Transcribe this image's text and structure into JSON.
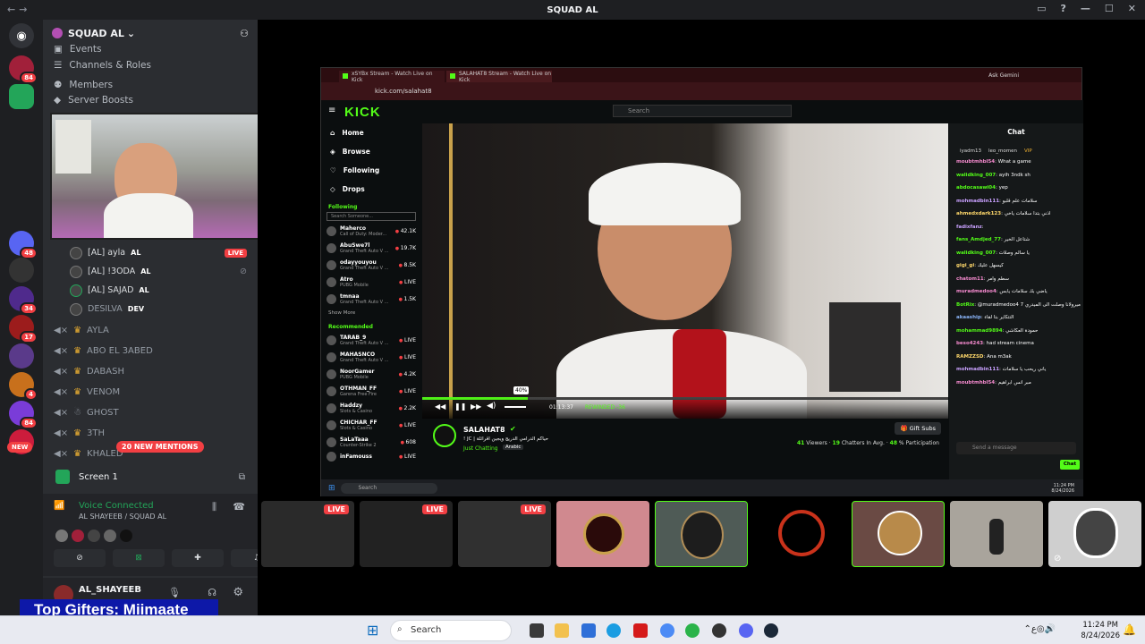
{
  "window": {
    "title": "SQUAD AL"
  },
  "server": {
    "name": "SQUAD AL",
    "menu": [
      "Events",
      "Channels & Roles",
      "Members",
      "Server Boosts"
    ]
  },
  "server_badges": [
    "84",
    "48",
    "34",
    "17",
    "4",
    "84",
    "NEW"
  ],
  "mentions": "20 NEW MENTIONS",
  "voice_users": [
    {
      "name": "[AL] ayla",
      "tag": "AL",
      "live": "LIVE"
    },
    {
      "name": "[AL] !3ODA",
      "tag": "AL"
    },
    {
      "name": "[AL] SAJAD",
      "tag": "AL"
    },
    {
      "name": "DESILVA",
      "tag": "DEV"
    }
  ],
  "category_users": [
    "AYLA",
    "ABO EL 3ABED",
    "DABASH",
    "VENOM",
    "GHOST",
    "3TH",
    "KHALED"
  ],
  "screen": {
    "label": "Screen 1"
  },
  "voice": {
    "status": "Voice Connected",
    "channel": "AL SHAYEEB / SQUAD AL"
  },
  "user": {
    "name": "AL_SHAYEEB"
  },
  "ticker": {
    "text": "Top Gifters: Miimaate"
  },
  "browser": {
    "tabs": [
      "xSYBx Stream - Watch Live on Kick",
      "SALAHAT8 Stream - Watch Live on Kick"
    ],
    "url": "kick.com/salahat8",
    "ask": "Ask Gemini"
  },
  "kick": {
    "logo": "KICK",
    "search_placeholder": "Search",
    "nav": [
      "Home",
      "Browse",
      "Following",
      "Drops"
    ],
    "following_header": "Following",
    "following_search": "Search Someone...",
    "following": [
      {
        "name": "Maherco",
        "game": "Call of Duty: Moder...",
        "count": "42.1K"
      },
      {
        "name": "AbuSwe7l",
        "game": "Grand Theft Auto V ...",
        "count": "19.7K"
      },
      {
        "name": "odayyouyou",
        "game": "Grand Theft Auto V ...",
        "count": "8.5K"
      },
      {
        "name": "Atro",
        "game": "PUBG Mobile",
        "count": "LIVE"
      },
      {
        "name": "tmnaa",
        "game": "Grand Theft Auto V ...",
        "count": "1.5K"
      }
    ],
    "show_more": "Show More",
    "recommended_header": "Recommended",
    "recommended": [
      {
        "name": "TARAB_9",
        "game": "Grand Theft Auto V ...",
        "count": "LIVE"
      },
      {
        "name": "MAHASNCO",
        "game": "Grand Theft Auto V ...",
        "count": "LIVE"
      },
      {
        "name": "NoorGamer",
        "game": "PUBG Mobile",
        "count": "4.2K"
      },
      {
        "name": "OTHMAN_FF",
        "game": "Garena Free Fire",
        "count": "LIVE"
      },
      {
        "name": "Haddzy",
        "game": "Slots & Casino",
        "count": "2.2K"
      },
      {
        "name": "CHICHAR_FF",
        "game": "Slots & Casino",
        "count": "LIVE"
      },
      {
        "name": "SaLaTaaa",
        "game": "Counter-Strike 2",
        "count": "608"
      },
      {
        "name": "inFamouss",
        "game": "",
        "count": "LIVE"
      }
    ],
    "player": {
      "time": "01:13:37",
      "rewind": "REWINDED -36",
      "volume": "40%",
      "progress": 0.2
    },
    "stream": {
      "name": "SALAHAT8",
      "title": "! JC | حياكم الدرامي الدريج ويجين اقرائلة",
      "category": "Just Chatting",
      "tag": "Arabic",
      "gift": "Gift Subs",
      "viewers": "41",
      "viewers_label": "Viewers",
      "chatters": "19",
      "chatters_label": "Chatters In Avg.",
      "participation": "48",
      "participation_label": "% Participation"
    },
    "chat": {
      "title": "Chat",
      "top": [
        "iyadm13",
        "leo_momen",
        "VIP"
      ],
      "messages": [
        {
          "user": "moubtmhbl54",
          "text": "What a game",
          "color": "#f78bd0"
        },
        {
          "user": "walidking_007",
          "text": "ayih 3ndk sh",
          "color": "#53fc18"
        },
        {
          "user": "abdocasawi04",
          "text": "yep",
          "color": "#53fc18"
        },
        {
          "user": "mohmadbin111",
          "text": "سلامات علم قلبو",
          "color": "#c9a1ff"
        },
        {
          "user": "ahmedxdark123",
          "text": "اذني بتدا سلامات ياخي",
          "color": "#ffd86b"
        },
        {
          "user": "fadixfanz",
          "text": "",
          "color": "#c9a1ff"
        },
        {
          "user": "fans_Amdjed_77",
          "text": "شتاعل الخير",
          "color": "#53fc18"
        },
        {
          "user": "walidking_007",
          "text": "يا سالم وصلات",
          "color": "#53fc18"
        },
        {
          "user": "gigi_gi",
          "text": "كيسهل عليك",
          "color": "#ffd86b"
        },
        {
          "user": "chatom11",
          "text": "سطم وامر",
          "color": "#f78bd0"
        },
        {
          "user": "muradmedoo4",
          "text": "ياضي بك سلامات يابس",
          "color": "#f78bd0"
        },
        {
          "user": "BotRix",
          "text": "@muradmedoo4 ميرولانا وصلت الى الميدري 7",
          "color": "#53fc18"
        },
        {
          "user": "akaaship",
          "text": "التتكاير بتا لقاء",
          "color": "#8ab4f8"
        },
        {
          "user": "mohammad9894",
          "text": "حمودة العكاشي",
          "color": "#53fc18"
        },
        {
          "user": "beso4243",
          "text": "had stream cinema",
          "color": "#f78bd0"
        },
        {
          "user": "RAMZZSD",
          "text": "Ana m3ak",
          "color": "#ffd86b"
        },
        {
          "user": "mohmadbin111",
          "text": "ياني ريحب يا سلامات",
          "color": "#c9a1ff"
        },
        {
          "user": "moubtmhbl54",
          "text": "مبر انس ابراهيم",
          "color": "#f78bd0"
        }
      ],
      "placeholder": "Send a message",
      "send": "Chat"
    }
  },
  "inner_taskbar": {
    "search": "Search",
    "time": "11:24 PM",
    "date": "8/24/2026"
  },
  "tiles": [
    {
      "live": "LIVE",
      "color": "#2a2a2a"
    },
    {
      "live": "LIVE",
      "color": "#222"
    },
    {
      "live": "LIVE",
      "color": "#303030"
    },
    {
      "color": "#d0898f",
      "label": "SYB"
    },
    {
      "color": "#4f5b56",
      "label": "SJ"
    },
    {
      "color": "#000000",
      "label": "M"
    },
    {
      "color": "#6a4a44",
      "label": "crown"
    },
    {
      "color": "#a9a49c",
      "label": "person"
    },
    {
      "color": "#cfcfcf",
      "label": "keffiyeh"
    }
  ],
  "taskbar": {
    "search": "Search",
    "time": "11:24 PM",
    "date": "8/24/2026",
    "lang": "ع"
  }
}
